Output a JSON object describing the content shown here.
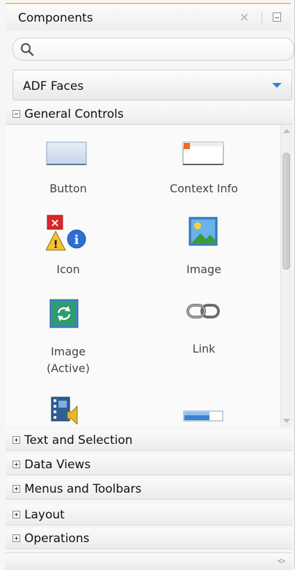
{
  "panel": {
    "title": "Components",
    "close_glyph": "×"
  },
  "search": {
    "value": "",
    "placeholder": ""
  },
  "library": {
    "selected": "ADF Faces"
  },
  "sections": {
    "general": "General Controls",
    "text_selection": "Text and Selection",
    "data_views": "Data Views",
    "menus_toolbars": "Menus and Toolbars",
    "layout": "Layout",
    "operations": "Operations"
  },
  "components": {
    "button": "Button",
    "context_info": "Context Info",
    "icon": "Icon",
    "image": "Image",
    "image_active_1": "Image",
    "image_active_2": "(Active)",
    "link": "Link"
  },
  "colors": {
    "title_accent": "#f0c060",
    "dropdown_arrow": "#3a7fd0"
  }
}
